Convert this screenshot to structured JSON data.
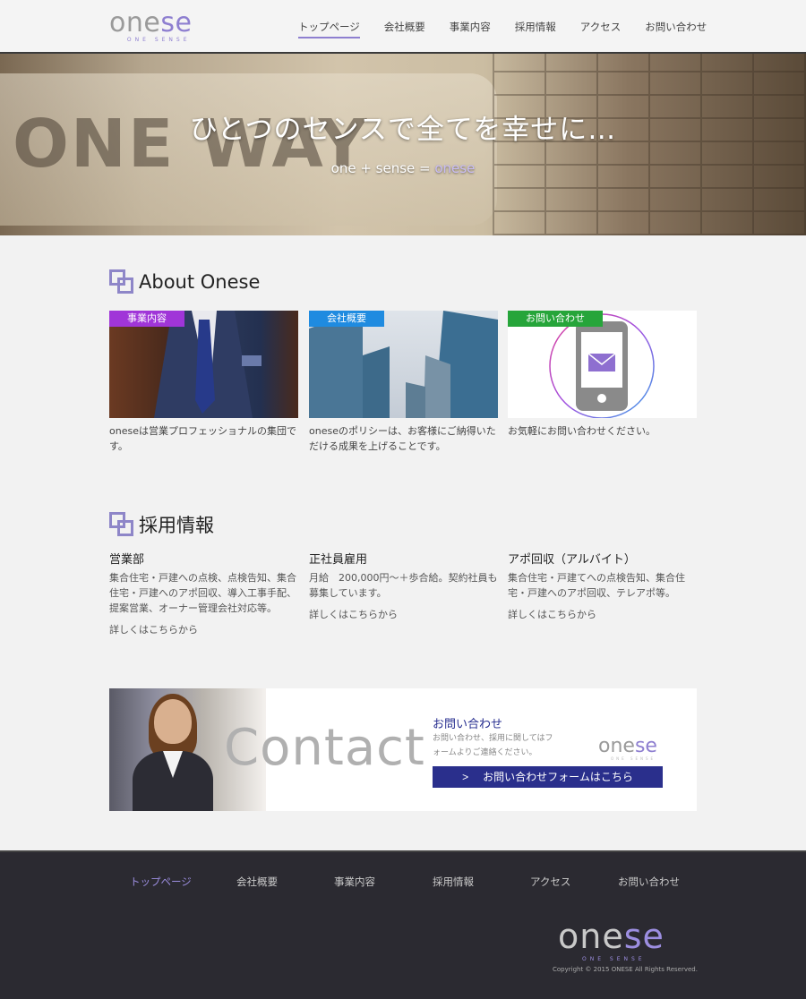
{
  "header": {
    "logo_prefix": "one",
    "logo_accent": "se",
    "logo_sub": "ONE SENSE",
    "nav": [
      "トップページ",
      "会社概要",
      "事業内容",
      "採用情報",
      "アクセス",
      "お問い合わせ"
    ]
  },
  "hero": {
    "title": "ひとつのセンスで全てを幸せに…",
    "sub_plain": "one + sense = ",
    "sub_accent": "onese",
    "sign_text": "ONE WAY"
  },
  "about": {
    "heading": "About Onese",
    "cards": [
      {
        "tag": "事業内容",
        "tag_color": "#a035d8",
        "text": "oneseは営業プロフェッショナルの集団です。"
      },
      {
        "tag": "会社概要",
        "tag_color": "#1f8be0",
        "text": "oneseのポリシーは、お客様にご納得いただける成果を上げることです。"
      },
      {
        "tag": "お問い合わせ",
        "tag_color": "#26a53a",
        "text": "お気軽にお問い合わせください。"
      }
    ]
  },
  "recruit": {
    "heading": "採用情報",
    "items": [
      {
        "title": "営業部",
        "text": "集合住宅・戸建への点検、点検告知、集合住宅・戸建へのアポ回収、導入工事手配、提案営業、オーナー管理会社対応等。",
        "link": "詳しくはこちらから"
      },
      {
        "title": "正社員雇用",
        "text": "月給　200,000円～＋歩合給。契約社員も募集しています。",
        "link": "詳しくはこちらから"
      },
      {
        "title": "アポ回収（アルバイト）",
        "text": "集合住宅・戸建てへの点検告知、集合住宅・戸建へのアポ回収、テレアポ等。",
        "link": "詳しくはこちらから"
      }
    ]
  },
  "contact": {
    "word": "Contact",
    "label": "お問い合わせ",
    "desc": "お問い合わせ、採用に関してはフォームよりご連絡ください。",
    "logo_prefix": "one",
    "logo_accent": "se",
    "logo_sub": "ONE SENSE",
    "button_arrow": ">",
    "button_label": "お問い合わせフォームはこちら"
  },
  "footer": {
    "nav": [
      "トップページ",
      "会社概要",
      "事業内容",
      "採用情報",
      "アクセス",
      "お問い合わせ"
    ],
    "logo_prefix": "one",
    "logo_accent": "se",
    "logo_sub": "ONE SENSE",
    "copyright": "Copyright © 2015 ONESE All Rights Reserved."
  },
  "colors": {
    "accent": "#8e7fd0",
    "contact_button": "#2a2f8c",
    "footer_bg": "#2b2a31"
  }
}
